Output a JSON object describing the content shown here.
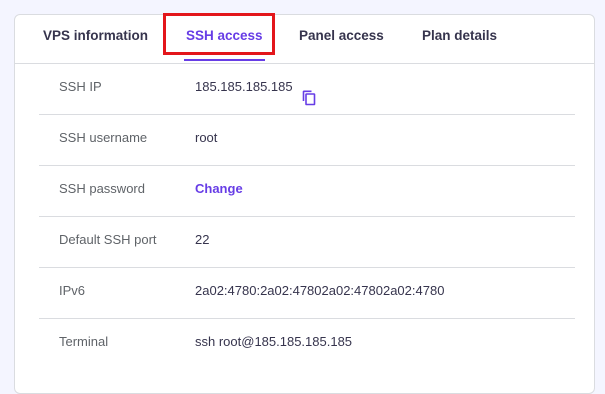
{
  "tabs": [
    {
      "label": "VPS information",
      "active": false
    },
    {
      "label": "SSH access",
      "active": true
    },
    {
      "label": "Panel access",
      "active": false
    },
    {
      "label": "Plan details",
      "active": false
    }
  ],
  "rows": [
    {
      "label": "SSH IP",
      "value": "185.185.185.185",
      "icon": "copy-icon"
    },
    {
      "label": "SSH username",
      "value": "root"
    },
    {
      "label": "SSH password",
      "value": "Change"
    },
    {
      "label": "Default SSH port",
      "value": "22"
    },
    {
      "label": "IPv6",
      "value": "2a02:4780:2a02:47802a02:47802a02:4780"
    },
    {
      "label": "Terminal",
      "value": "ssh root@185.185.185.185"
    }
  ],
  "colors": {
    "accent": "#673de6",
    "highlight": "#e3161b",
    "text": "#36344d",
    "label": "#5f6368",
    "border": "#dadce0"
  }
}
